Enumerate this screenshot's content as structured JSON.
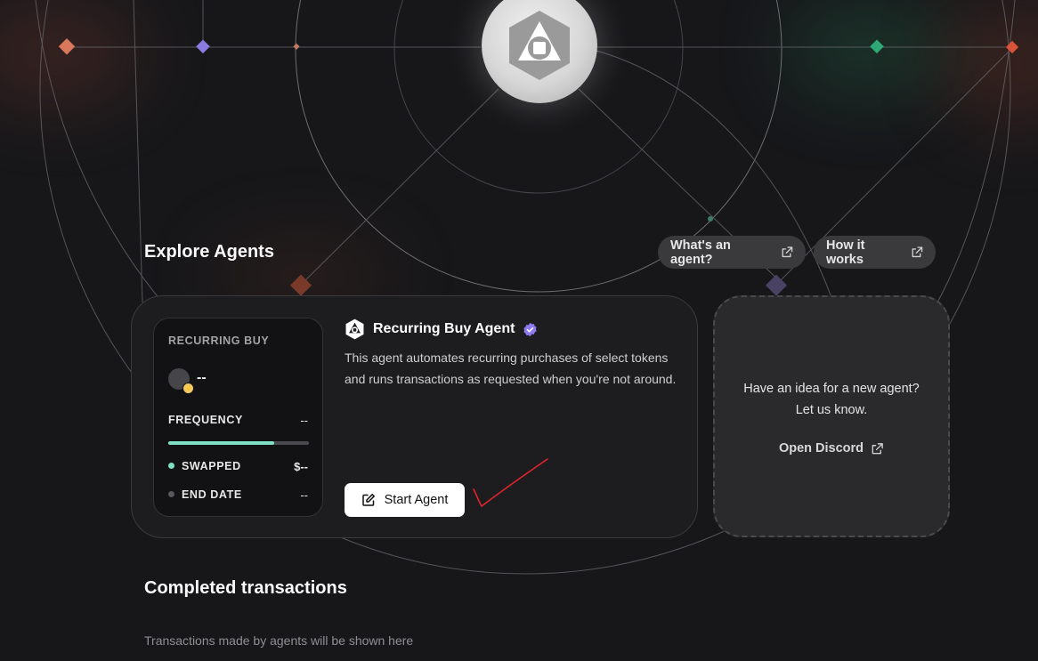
{
  "explore": {
    "title": "Explore Agents",
    "whats_agent": "What's an agent?",
    "how_it_works": "How it works"
  },
  "agent_card": {
    "preview": {
      "type_label": "RECURRING BUY",
      "token_amount": "--",
      "frequency_label": "FREQUENCY",
      "frequency_value": "--",
      "progress": 0.75,
      "swapped_label": "SWAPPED",
      "swapped_value": "$--",
      "end_date_label": "END DATE",
      "end_date_value": "--"
    },
    "name": "Recurring Buy Agent",
    "description": "This agent automates recurring purchases of select tokens and runs transactions as requested when you're not around.",
    "start_label": "Start Agent"
  },
  "idea_card": {
    "line1": "Have an idea for a new agent?",
    "line2": "Let us know.",
    "discord_label": "Open Discord"
  },
  "completed": {
    "title": "Completed transactions",
    "empty_text": "Transactions made by agents will be shown here"
  },
  "colors": {
    "accent_teal": "#7fe0c3",
    "verified_purple": "#8e7bef",
    "annotation_red": "#e0242b",
    "background": "#17171a"
  }
}
